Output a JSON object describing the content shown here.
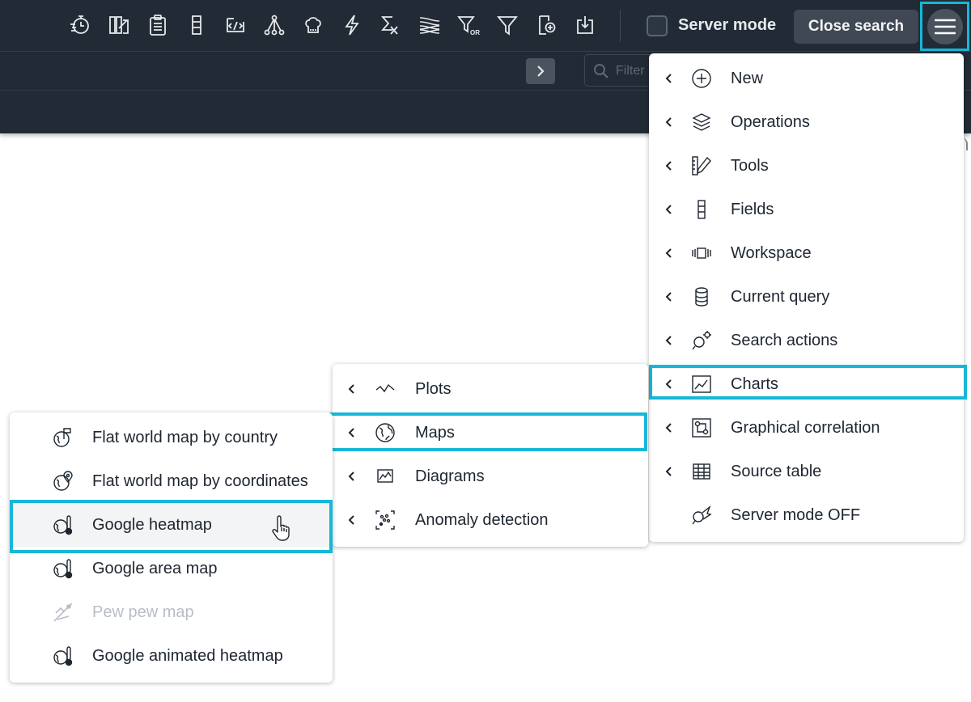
{
  "toolbar": {
    "icons": [
      "timer-icon",
      "hide-columns-icon",
      "clipboard-icon",
      "field-column-icon",
      "code-icon",
      "graph-nodes-icon",
      "chef-hat-icon",
      "lightning-icon",
      "sigma-formula-icon",
      "stack-icon",
      "filter-or-icon",
      "filter-icon",
      "add-document-icon",
      "download-icon"
    ],
    "server_mode_label": "Server mode",
    "close_search_label": "Close search"
  },
  "subbar": {
    "filter_placeholder": "Filter"
  },
  "main_menu": {
    "items": [
      {
        "label": "New",
        "icon": "plus-circle-icon",
        "submenu": true
      },
      {
        "label": "Operations",
        "icon": "layers-icon",
        "submenu": true
      },
      {
        "label": "Tools",
        "icon": "ruler-pencil-icon",
        "submenu": true
      },
      {
        "label": "Fields",
        "icon": "field-column-icon",
        "submenu": true
      },
      {
        "label": "Workspace",
        "icon": "workspace-icon",
        "submenu": true
      },
      {
        "label": "Current query",
        "icon": "database-icon",
        "submenu": true
      },
      {
        "label": "Search actions",
        "icon": "search-gear-icon",
        "submenu": true
      },
      {
        "label": "Charts",
        "icon": "chart-icon",
        "submenu": true,
        "selected": true
      },
      {
        "label": "Graphical correlation",
        "icon": "correlation-icon",
        "submenu": true
      },
      {
        "label": "Source table",
        "icon": "table-icon",
        "submenu": true
      },
      {
        "label": "Server mode OFF",
        "icon": "server-mode-icon",
        "submenu": false
      }
    ]
  },
  "charts_menu": {
    "items": [
      {
        "label": "Plots",
        "icon": "plot-icon"
      },
      {
        "label": "Maps",
        "icon": "globe-icon",
        "selected": true
      },
      {
        "label": "Diagrams",
        "icon": "diagram-icon"
      },
      {
        "label": "Anomaly detection",
        "icon": "anomaly-icon"
      }
    ]
  },
  "maps_menu": {
    "items": [
      {
        "label": "Flat world map by country",
        "icon": "globe-flag-icon"
      },
      {
        "label": "Flat world map by coordinates",
        "icon": "globe-pin-icon"
      },
      {
        "label": "Google heatmap",
        "icon": "globe-thermometer-icon",
        "selected": true
      },
      {
        "label": "Google area map",
        "icon": "globe-thermometer-icon"
      },
      {
        "label": "Pew pew map",
        "icon": "pew-pew-icon",
        "disabled": true
      },
      {
        "label": "Google animated heatmap",
        "icon": "globe-thermometer-icon"
      }
    ]
  },
  "colors": {
    "accent": "#17b7d7",
    "topbar": "#222b35",
    "text": "#1e2630"
  }
}
